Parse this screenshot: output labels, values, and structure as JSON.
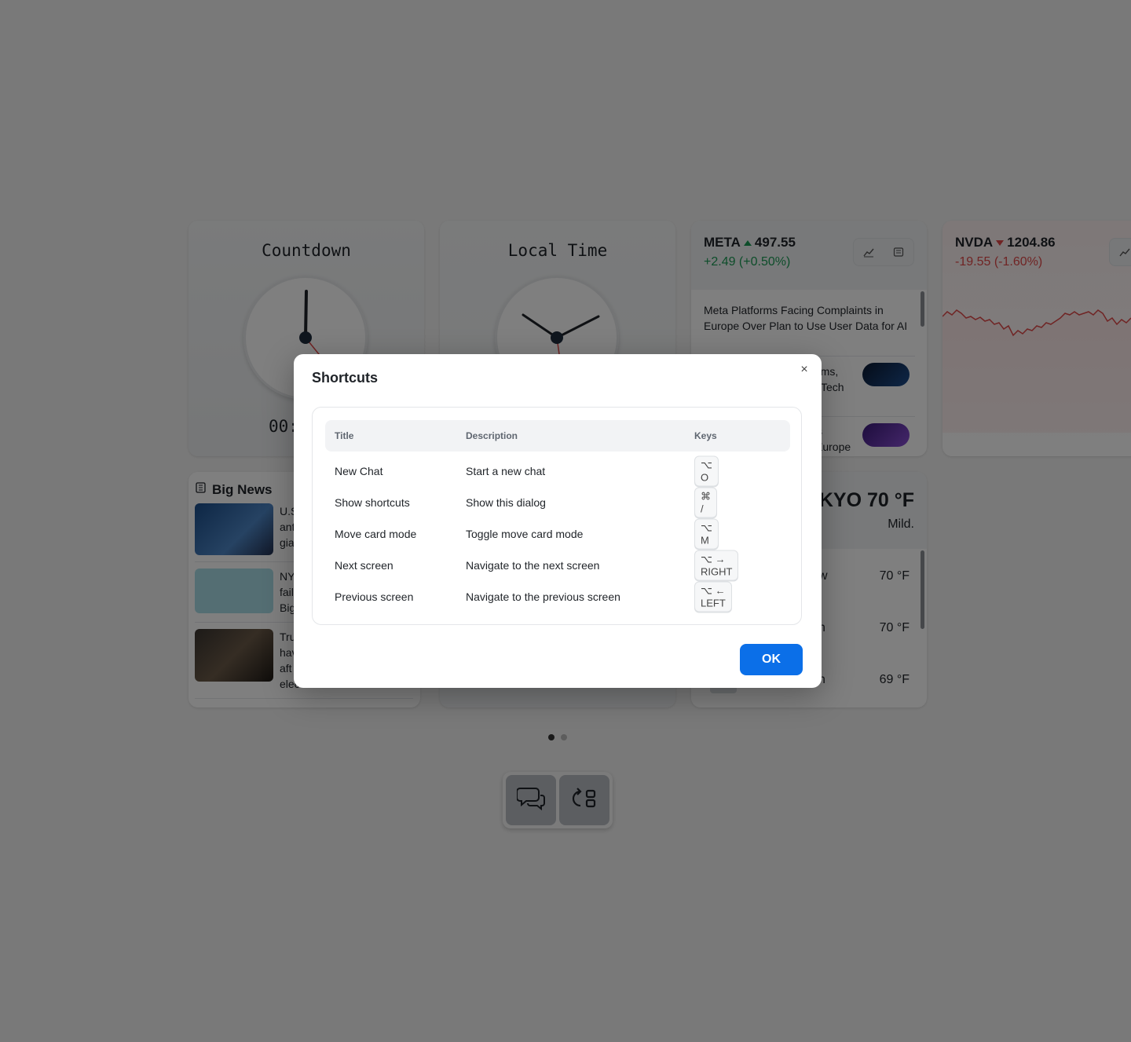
{
  "cards": {
    "countdown": {
      "title": "Countdown",
      "readout": "00:"
    },
    "local_time": {
      "title": "Local Time"
    },
    "meta": {
      "ticker": "META",
      "price": "497.55",
      "change": "+2.49 (+0.50%)",
      "news": [
        "Meta Platforms Facing Complaints in Europe Over Plan to Use User Data for AI",
        "rms,",
        "Tech",
        "s",
        "Europe"
      ]
    },
    "nvda": {
      "ticker": "NVDA",
      "price": "1204.86",
      "change": "-19.55 (-1.60%)"
    },
    "big_news": {
      "title": "Big News",
      "items": [
        {
          "lines": [
            "U.S",
            "ant",
            "gia"
          ]
        },
        {
          "lines": [
            "NY",
            "fail",
            "Big"
          ]
        },
        {
          "lines": [
            "Tru",
            "hav",
            "aft",
            "elec"
          ]
        }
      ]
    },
    "weather": {
      "title": "KYO 70 °F",
      "subtitle": "Mild.",
      "rows": [
        {
          "label": "w",
          "temp": "70 °F"
        },
        {
          "label": "n",
          "temp": "70 °F"
        },
        {
          "label": "n",
          "temp": "69 °F"
        }
      ]
    }
  },
  "pager": {
    "count": 2,
    "active": 0
  },
  "dialog": {
    "title": "Shortcuts",
    "close_label": "×",
    "headers": {
      "title": "Title",
      "description": "Description",
      "keys": "Keys"
    },
    "rows": [
      {
        "title": "New Chat",
        "description": "Start a new chat",
        "keys": "⌥ O"
      },
      {
        "title": "Show shortcuts",
        "description": "Show this dialog",
        "keys": "⌘ /"
      },
      {
        "title": "Move card mode",
        "description": "Toggle move card mode",
        "keys": "⌥ M"
      },
      {
        "title": "Next screen",
        "description": "Navigate to the next screen",
        "keys": "⌥ → RIGHT"
      },
      {
        "title": "Previous screen",
        "description": "Navigate to the previous screen",
        "keys": "⌥ ← LEFT"
      }
    ],
    "ok_label": "OK"
  },
  "colors": {
    "accent": "#0b6fe8",
    "up": "#1a9b55",
    "down": "#e04848"
  }
}
